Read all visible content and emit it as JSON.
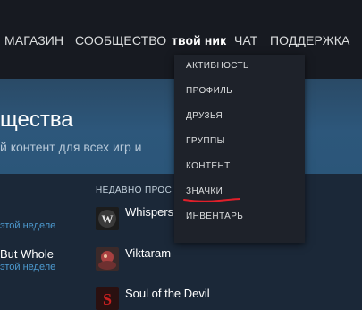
{
  "nav": {
    "store": "МАГАЗИН",
    "community": "СООБЩЕСТВО",
    "username": "твой ник",
    "chat": "ЧАТ",
    "support": "ПОДДЕРЖКА"
  },
  "dropdown": {
    "items": [
      "АКТИВНОСТЬ",
      "ПРОФИЛЬ",
      "ДРУЗЬЯ",
      "ГРУППЫ",
      "КОНТЕНТ",
      "ЗНАЧКИ",
      "ИНВЕНТАРЬ"
    ],
    "highlighted": "ЗНАЧКИ",
    "underline_color": "#e0202a"
  },
  "hero": {
    "title": "щества",
    "subtitle": "й контент для всех игр и"
  },
  "left_column": {
    "week_1": "этой неделе",
    "game_partial": "But Whole",
    "week_2": "этой неделе"
  },
  "recent": {
    "label": "НЕДАВНО ПРОС",
    "games": [
      {
        "name": "Whispers",
        "icon": "whispers-game-icon"
      },
      {
        "name": "Viktaram",
        "icon": "viktaram-game-icon"
      },
      {
        "name": "Soul of the Devil",
        "icon": "soul-of-the-devil-game-icon"
      }
    ]
  },
  "colors": {
    "nav_bg": "#171a21",
    "page_bg": "#1b2838",
    "link_blue": "#4d9bd1",
    "dropdown_bg": "#1e222a"
  }
}
